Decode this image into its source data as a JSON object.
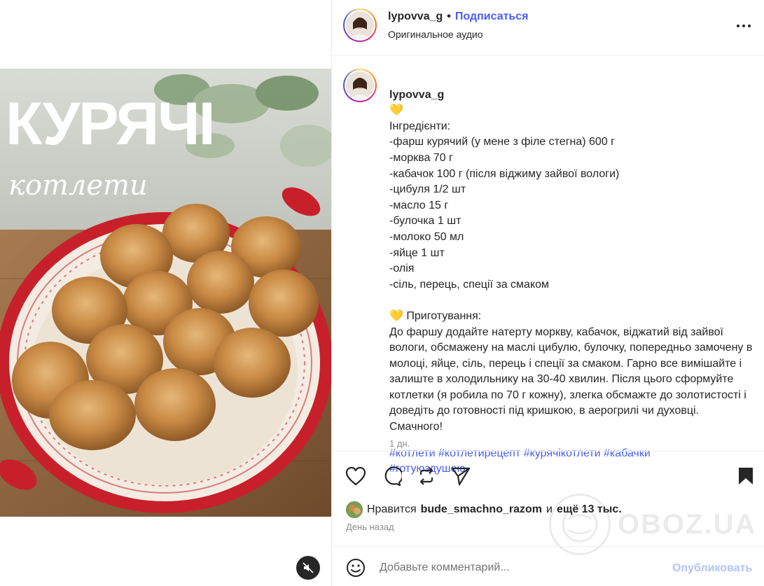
{
  "post": {
    "image_title_main": "КУРЯЧІ",
    "image_title_script": "котлети"
  },
  "header": {
    "username": "lypovva_g",
    "dot": "•",
    "follow_label": "Подписаться",
    "audio_label": "Оригинальное аудио"
  },
  "caption": {
    "username": "lypovva_g",
    "heart": "💛",
    "ingredients_title": "Інгредієнти:",
    "ingredients": [
      "-фарш курячий (у мене з філе стегна) 600 г",
      "-морква 70 г",
      "-кабачок 100 г (після віджиму зайвої вологи)",
      "-цибуля 1/2 шт",
      "-масло 15 г",
      "-булочка 1 шт",
      "-молоко 50 мл",
      "-яйце 1 шт",
      "-олія",
      "-сіль, перець, спеції за смаком"
    ],
    "prep_title": "💛 Приготування:",
    "prep_text": "До фаршу додайте натерту моркву, кабачок, віджатий від зайвої вологи, обсмажену на маслі цибулю, булочку, попередньо замочену в молоці, яйце, сіль, перець і спеції за смаком. Гарно все вимішайте і залиште в холодильнику на 30-40 хвилин. Після цього сформуйте котлетки (я робила по 70 г кожну), злегка обсмажте до золотистості і доведіть до готовності під кришкою, в аерогрилі чи духовці. Смачного!",
    "hashtags": [
      "#котлети",
      "#котлетирецепт",
      "#курячікотлети",
      "#кабачки",
      "#готуюздушею"
    ],
    "time": "1 дн."
  },
  "likes": {
    "prefix": "Нравится",
    "user": "bude_smachno_razom",
    "middle": "и",
    "more": "ещё 13 тыс.",
    "ago": "День назад"
  },
  "comment": {
    "placeholder": "Добавьте комментарий...",
    "publish_label": "Опубликовать"
  },
  "watermark": {
    "text": "OBOZ.UA"
  },
  "icons": {
    "like": "heart-icon",
    "comment": "comment-icon",
    "repost": "repost-icon",
    "share": "share-icon",
    "save": "bookmark-icon",
    "more": "more-icon",
    "mute": "speaker-muted-icon",
    "emoji": "emoji-icon"
  },
  "colors": {
    "link_blue": "#4a5cf4",
    "publish_disabled": "#b3c3f7",
    "text_primary": "#262626",
    "text_secondary": "#8e8e8e",
    "dish_red": "#c8202b"
  }
}
